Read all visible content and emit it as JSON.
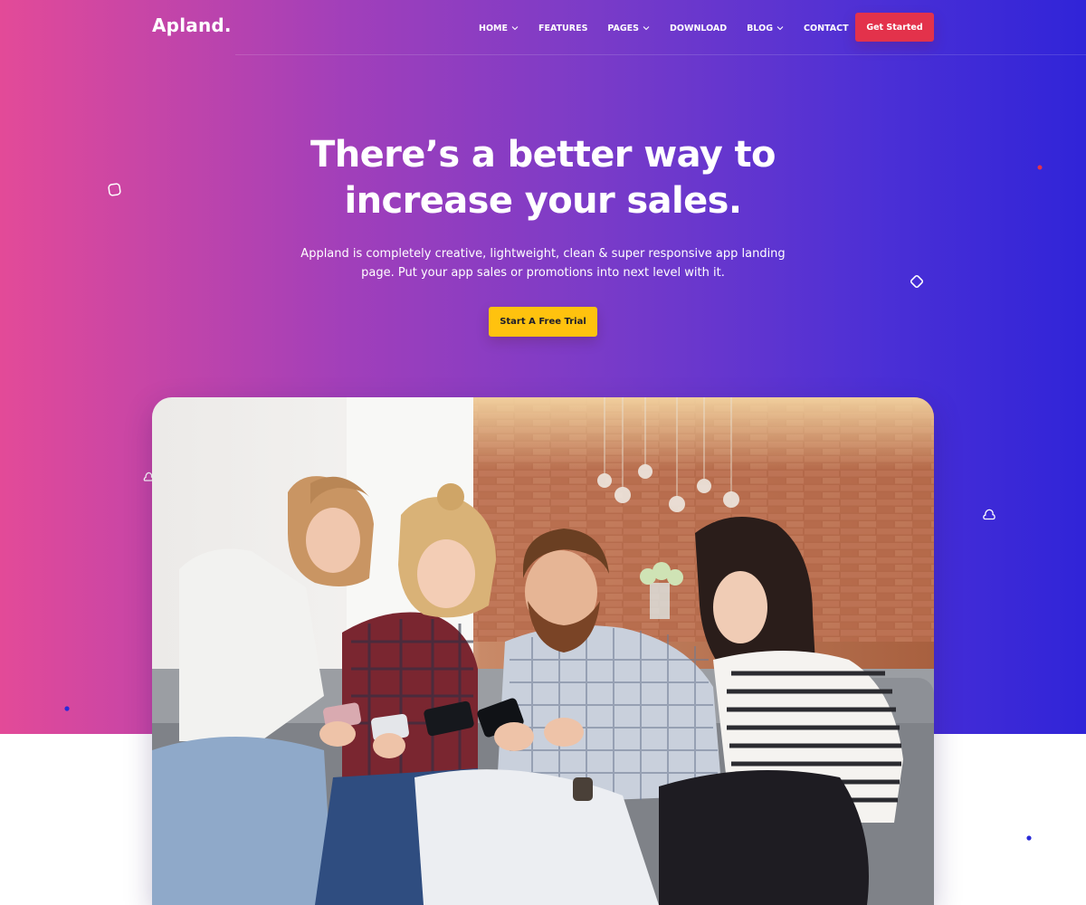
{
  "brand": {
    "logo": "Apland."
  },
  "nav": {
    "items": [
      {
        "label": "HOME",
        "dropdown": true
      },
      {
        "label": "FEATURES",
        "dropdown": false
      },
      {
        "label": "PAGES",
        "dropdown": true
      },
      {
        "label": "DOWNLOAD",
        "dropdown": false
      },
      {
        "label": "BLOG",
        "dropdown": true
      },
      {
        "label": "CONTACT",
        "dropdown": false
      }
    ],
    "cta_label": "Get Started"
  },
  "hero": {
    "headline_line1": "There’s a better way to",
    "headline_line2": "increase your sales.",
    "subtext_line1": "Appland is completely creative, lightweight, clean & super responsive app landing",
    "subtext_line2": "page. Put your app sales or promotions into next level with it.",
    "cta_label": "Start A Free Trial"
  },
  "colors": {
    "gradient_start": "#e34a98",
    "gradient_end": "#3024d8",
    "cta_red": "#e3324b",
    "cta_yellow": "#ffc20e"
  },
  "icons": {
    "dropdown": "chevron-down-icon",
    "decor": [
      "rounded-square-outline",
      "diamond-outline",
      "cloud-outline",
      "dot"
    ]
  }
}
